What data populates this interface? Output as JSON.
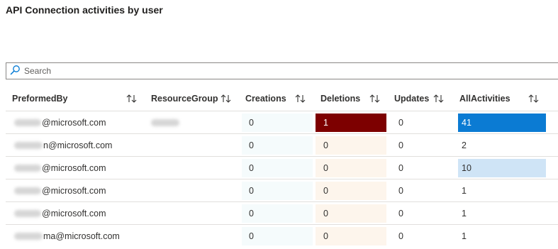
{
  "title": "API Connection activities by user",
  "search": {
    "placeholder": "Search",
    "value": ""
  },
  "columns": [
    {
      "key": "preformed_by",
      "label": "PreformedBy"
    },
    {
      "key": "resource_group",
      "label": "ResourceGroup"
    },
    {
      "key": "creations",
      "label": "Creations"
    },
    {
      "key": "deletions",
      "label": "Deletions"
    },
    {
      "key": "updates",
      "label": "Updates"
    },
    {
      "key": "all_activities",
      "label": "AllActivities"
    }
  ],
  "sort_icon": "sort-updown-icon",
  "rows": [
    {
      "user": "@microsoft.com",
      "resource_group": "",
      "creations": "0",
      "deletions": "1",
      "updates": "0",
      "all_activities": "41"
    },
    {
      "user": "n@microsoft.com",
      "resource_group": "",
      "creations": "0",
      "deletions": "0",
      "updates": "0",
      "all_activities": "2"
    },
    {
      "user": "@microsoft.com",
      "resource_group": "",
      "creations": "0",
      "deletions": "0",
      "updates": "0",
      "all_activities": "10"
    },
    {
      "user": "@microsoft.com",
      "resource_group": "",
      "creations": "0",
      "deletions": "0",
      "updates": "0",
      "all_activities": "1"
    },
    {
      "user": "@microsoft.com",
      "resource_group": "",
      "creations": "0",
      "deletions": "0",
      "updates": "0",
      "all_activities": "1"
    },
    {
      "user": "ma@microsoft.com",
      "resource_group": "",
      "creations": "0",
      "deletions": "0",
      "updates": "0",
      "all_activities": "1"
    }
  ],
  "colors": {
    "heat_deletions_high": "#7d0000",
    "heat_all_high": "#0b7bd3",
    "heat_all_mid": "#cfe4f6",
    "creations_bg": "#f5fbfc",
    "deletions_bg": "#fdf5ec"
  }
}
